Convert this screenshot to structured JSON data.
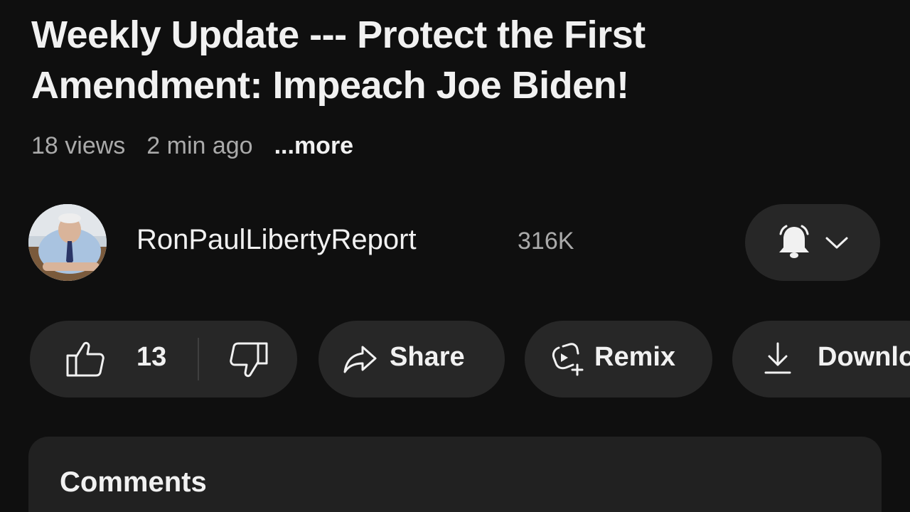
{
  "video": {
    "title": "Weekly Update --- Protect the First Amendment: Impeach Joe Biden!",
    "views": "18 views",
    "age": "2 min ago",
    "more_label": "...more"
  },
  "channel": {
    "name": "RonPaulLibertyReport",
    "subscribers": "316K",
    "avatar": "avatar-photo",
    "bell_icon": "bell-icon",
    "chevron_icon": "chevron-down-icon"
  },
  "actions": {
    "like_count": "13",
    "like_icon": "thumbs-up-icon",
    "dislike_icon": "thumbs-down-icon",
    "share_label": "Share",
    "share_icon": "share-icon",
    "remix_label": "Remix",
    "remix_icon": "remix-icon",
    "download_label": "Download",
    "download_icon": "download-icon"
  },
  "comments": {
    "title": "Comments"
  },
  "colors": {
    "background": "#0f0f0f",
    "pill": "#272727",
    "panel": "#212121",
    "text_primary": "#f1f1f1",
    "text_secondary": "#aaaaaa"
  }
}
